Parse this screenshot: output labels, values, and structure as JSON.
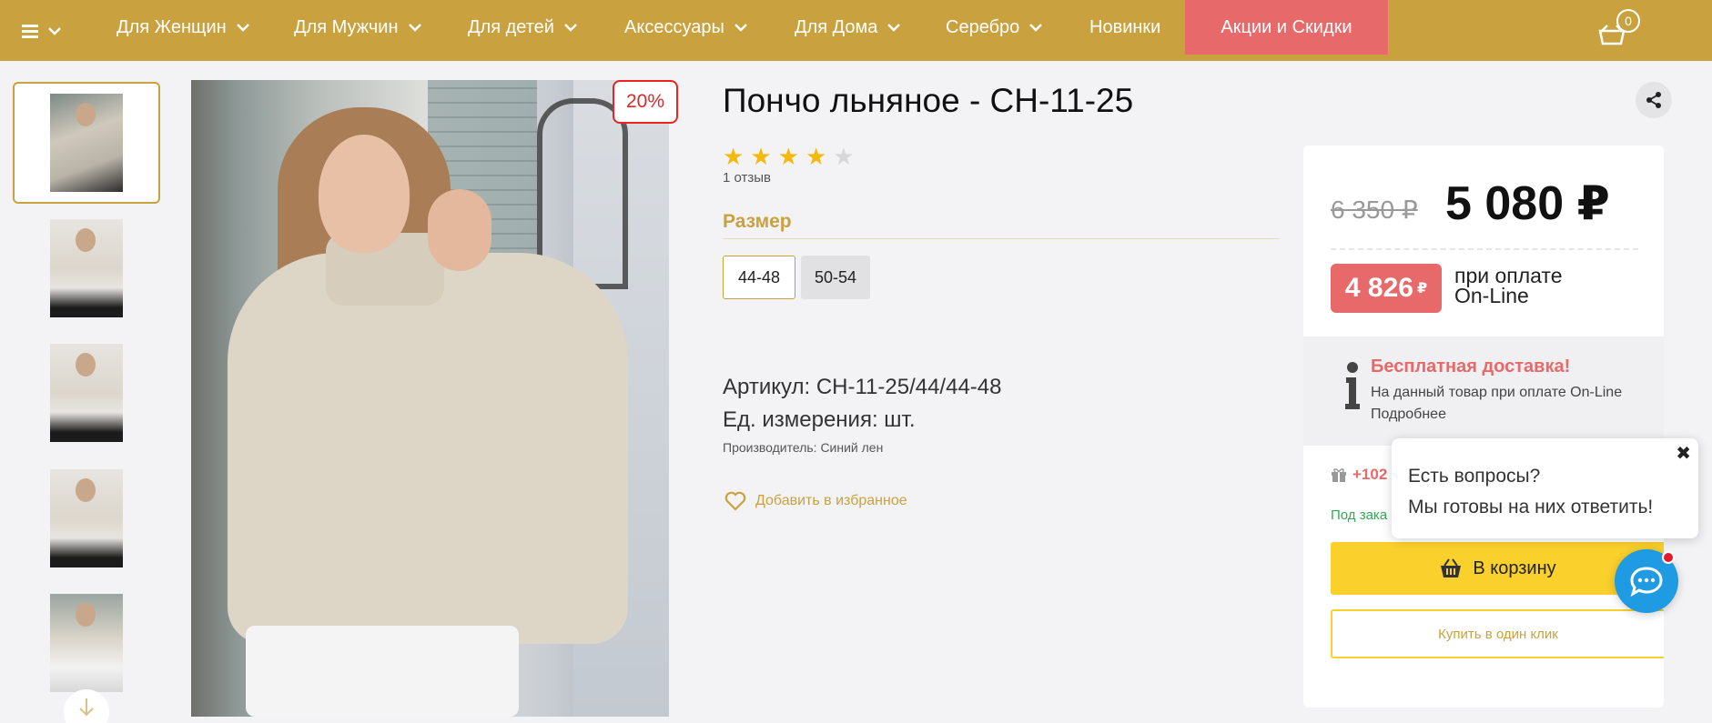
{
  "nav": {
    "items": [
      {
        "label": "Для Женщин"
      },
      {
        "label": "Для Мужчин"
      },
      {
        "label": "Для детей"
      },
      {
        "label": "Аксессуары"
      },
      {
        "label": "Для Дома"
      },
      {
        "label": "Серебро"
      },
      {
        "label": "Новинки"
      }
    ],
    "sale_label": "Акции и Скидки",
    "cart_count": "0",
    "colors": {
      "bar": "#c9a23f",
      "sale": "#e8696a"
    }
  },
  "gallery": {
    "thumbnail_count": 5,
    "active_index": 0,
    "discount_badge": "20%"
  },
  "product": {
    "title": "Пончо льняное - СН-11-25",
    "rating": 4,
    "rating_max": 5,
    "reviews": "1 отзыв",
    "size_heading": "Размер",
    "sizes": [
      {
        "label": "44-48",
        "selected": true
      },
      {
        "label": "50-54",
        "selected": false
      }
    ],
    "article_label": "Артикул:",
    "article_value": "СН-11-25/44/44-48",
    "unit_label": "Ед. измерения:",
    "unit_value": "шт.",
    "manufacturer": "Производитель: Синий лен",
    "favorite_label": "Добавить в избранное"
  },
  "price": {
    "old": "6 350 ₽",
    "current": "5 080 ₽",
    "online_value": "4 826",
    "online_currency": "₽",
    "online_text_1": "при оплате",
    "online_text_2": "On-Line",
    "delivery_heading": "Бесплатная доставка!",
    "delivery_text_1": "На данный товар при оплате On-Line",
    "delivery_link": "Подробнее",
    "bonus": "+102",
    "order_status": "Под зака",
    "cart_button": "В корзину",
    "one_click_button": "Купить в один клик"
  },
  "chat": {
    "line_1": "Есть вопросы?",
    "line_2": "Мы готовы на них ответить!"
  },
  "icons": {
    "menu": "hamburger-icon",
    "cart": "basket-icon",
    "share": "share-icon",
    "info": "info-icon",
    "gift": "gift-icon",
    "heart": "heart-icon",
    "chat": "chat-bubble-icon",
    "close": "close-icon",
    "arrow_down": "arrow-down-icon"
  }
}
